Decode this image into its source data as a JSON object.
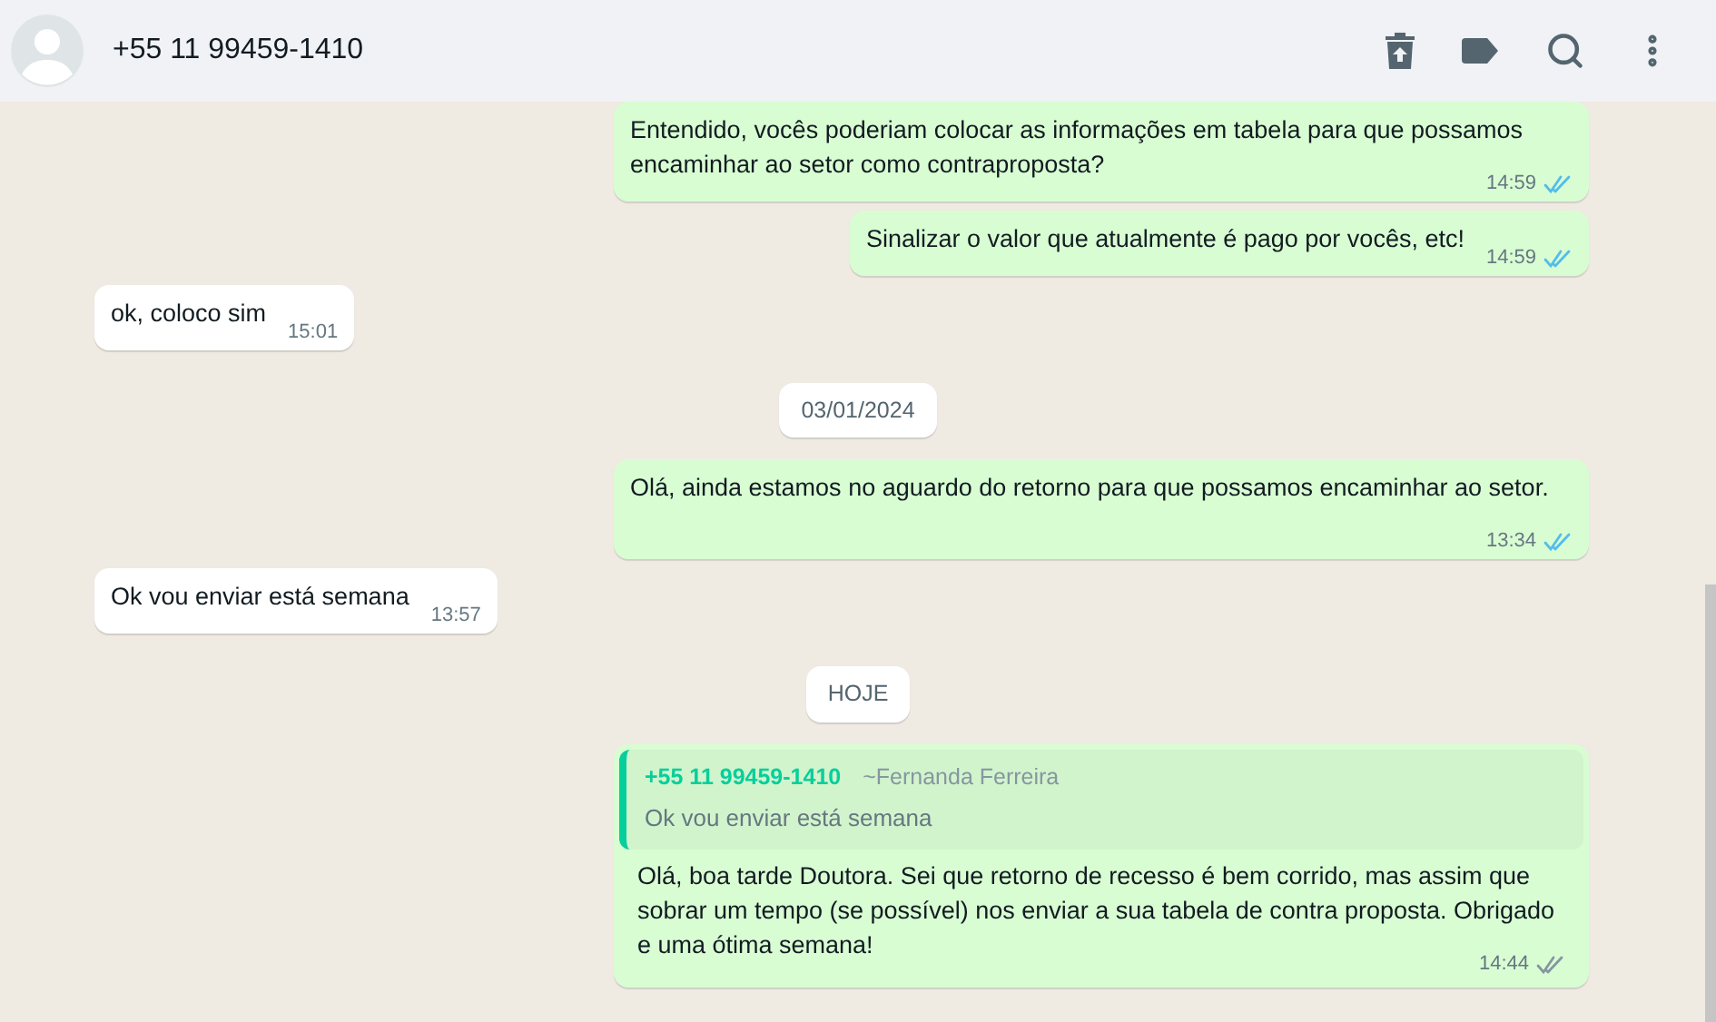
{
  "header": {
    "title": "+55 11 99459-1410"
  },
  "messages": [
    {
      "kind": "out",
      "text": "Entendido, vocês poderiam colocar as informações em tabela para que possamos encaminhar ao setor como contraproposta?",
      "time": "14:59",
      "read": true
    },
    {
      "kind": "out",
      "text": "Sinalizar o valor que atualmente é pago por vocês, etc!",
      "time": "14:59",
      "read": true
    },
    {
      "kind": "in",
      "text": "ok, coloco sim",
      "time": "15:01"
    },
    {
      "kind": "date",
      "text": "03/01/2024"
    },
    {
      "kind": "out",
      "text": "Olá, ainda estamos no aguardo do retorno para que possamos encaminhar ao setor.",
      "time": "13:34",
      "read": true
    },
    {
      "kind": "in",
      "text": "Ok vou enviar está semana",
      "time": "13:57"
    },
    {
      "kind": "date",
      "text": "HOJE"
    },
    {
      "kind": "out",
      "quote": {
        "author": "+55 11 99459-1410",
        "name": "~Fernanda Ferreira",
        "text": "Ok vou enviar está semana"
      },
      "text": "Olá, boa tarde Doutora. Sei que retorno de recesso é bem corrido, mas assim que sobrar um tempo (se possível) nos enviar a sua tabela de contra proposta. Obrigado e uma ótima semana!",
      "time": "14:44",
      "read": false
    }
  ]
}
